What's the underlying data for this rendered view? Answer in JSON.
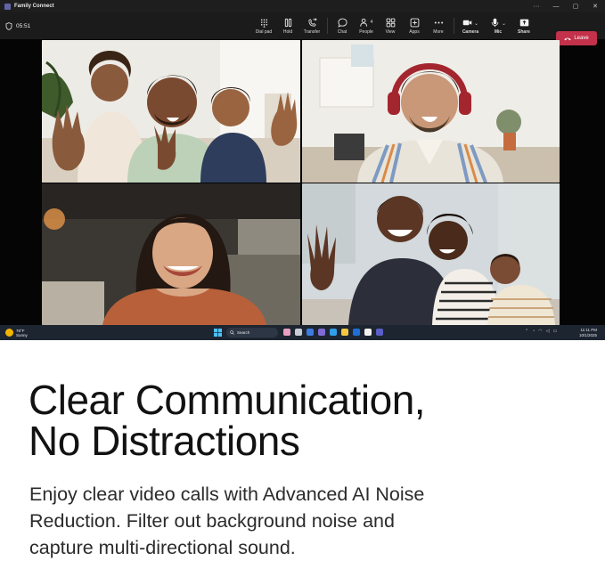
{
  "window": {
    "title": "Family Connect",
    "controls": [
      "more",
      "minimize",
      "maximize",
      "close"
    ]
  },
  "call": {
    "elapsed": "05:51",
    "toolbar": [
      {
        "label": "Dial pad",
        "icon": "dialpad-icon"
      },
      {
        "label": "Hold",
        "icon": "pause-icon"
      },
      {
        "label": "Transfer",
        "icon": "transfer-icon"
      },
      {
        "label": "Chat",
        "icon": "chat-icon"
      },
      {
        "label": "People",
        "icon": "people-icon",
        "count": "4"
      },
      {
        "label": "View",
        "icon": "view-icon"
      },
      {
        "label": "Apps",
        "icon": "apps-icon"
      },
      {
        "label": "More",
        "icon": "more-icon"
      },
      {
        "label": "Camera",
        "icon": "camera-icon"
      },
      {
        "label": "Mic",
        "icon": "mic-icon"
      },
      {
        "label": "Share",
        "icon": "share-icon"
      }
    ],
    "leave_label": "Leave",
    "colors": {
      "leave": "#c4314b",
      "toolbar": "#1b1b1b",
      "brand": "#6264a7"
    },
    "participants": [
      {
        "tile": "family-group-waving"
      },
      {
        "tile": "man-with-headphones"
      },
      {
        "tile": "smiling-woman"
      },
      {
        "tile": "family-with-baby"
      }
    ]
  },
  "taskbar": {
    "weather_temp": "78°F",
    "weather_desc": "Sunny",
    "search_placeholder": "Search",
    "time": "11:11 PM",
    "date": "10/1/2025"
  },
  "marketing": {
    "headline_line1": "Clear Communication,",
    "headline_line2": "No Distractions",
    "body_line1": "Enjoy clear video calls with Advanced AI Noise",
    "body_line2": "Reduction. Filter out background noise and",
    "body_line3": "capture multi-directional sound."
  }
}
